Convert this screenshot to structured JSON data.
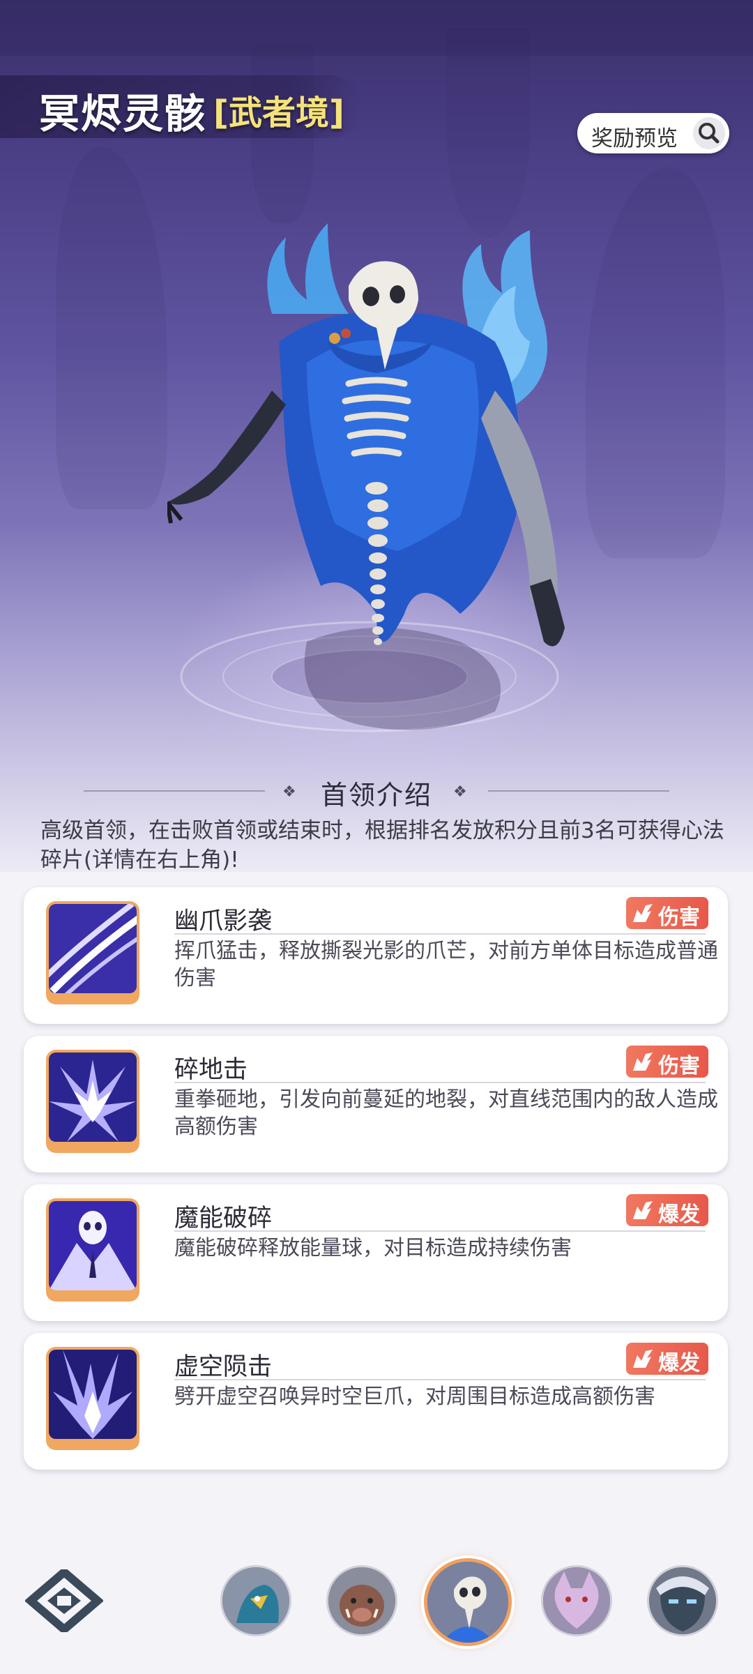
{
  "header": {
    "boss_name": "冥烬灵骸",
    "boss_realm": "[武者境]",
    "reward_button_label": "奖励预览",
    "reward_icon": "search-icon"
  },
  "intro": {
    "section_title": "首领介绍",
    "description": "高级首领，在击败首领或结束时，根据排名发放积分且前3名可获得心法碎片(详情在右上角)!"
  },
  "skills": [
    {
      "name": "幽爪影袭",
      "tag": "伤害",
      "description": "挥爪猛击，释放撕裂光影的爪芒，对前方单体目标造成普通伤害",
      "icon": "claw-slash-icon"
    },
    {
      "name": "碎地击",
      "tag": "伤害",
      "description": "重拳砸地，引发向前蔓延的地裂，对直线范围内的敌人造成高额伤害",
      "icon": "ground-crack-icon"
    },
    {
      "name": "魔能破碎",
      "tag": "爆发",
      "description": "魔能破碎释放能量球，对目标造成持续伤害",
      "icon": "skull-burst-icon"
    },
    {
      "name": "虚空陨击",
      "tag": "爆发",
      "description": "劈开虚空召唤异时空巨爪，对周围目标造成高额伤害",
      "icon": "void-claw-icon"
    }
  ],
  "bottom_nav": {
    "logo_icon": "game-logo-icon",
    "bosses": [
      {
        "name": "bird-beast-boss",
        "active": false
      },
      {
        "name": "boar-boss",
        "active": false
      },
      {
        "name": "skull-wraith-boss",
        "active": true
      },
      {
        "name": "wolf-boss",
        "active": false
      },
      {
        "name": "masked-boss",
        "active": false
      }
    ]
  },
  "colors": {
    "accent": "#f0a060",
    "tag_red": "#e8584a",
    "realm_gold": "#f6e27a"
  }
}
